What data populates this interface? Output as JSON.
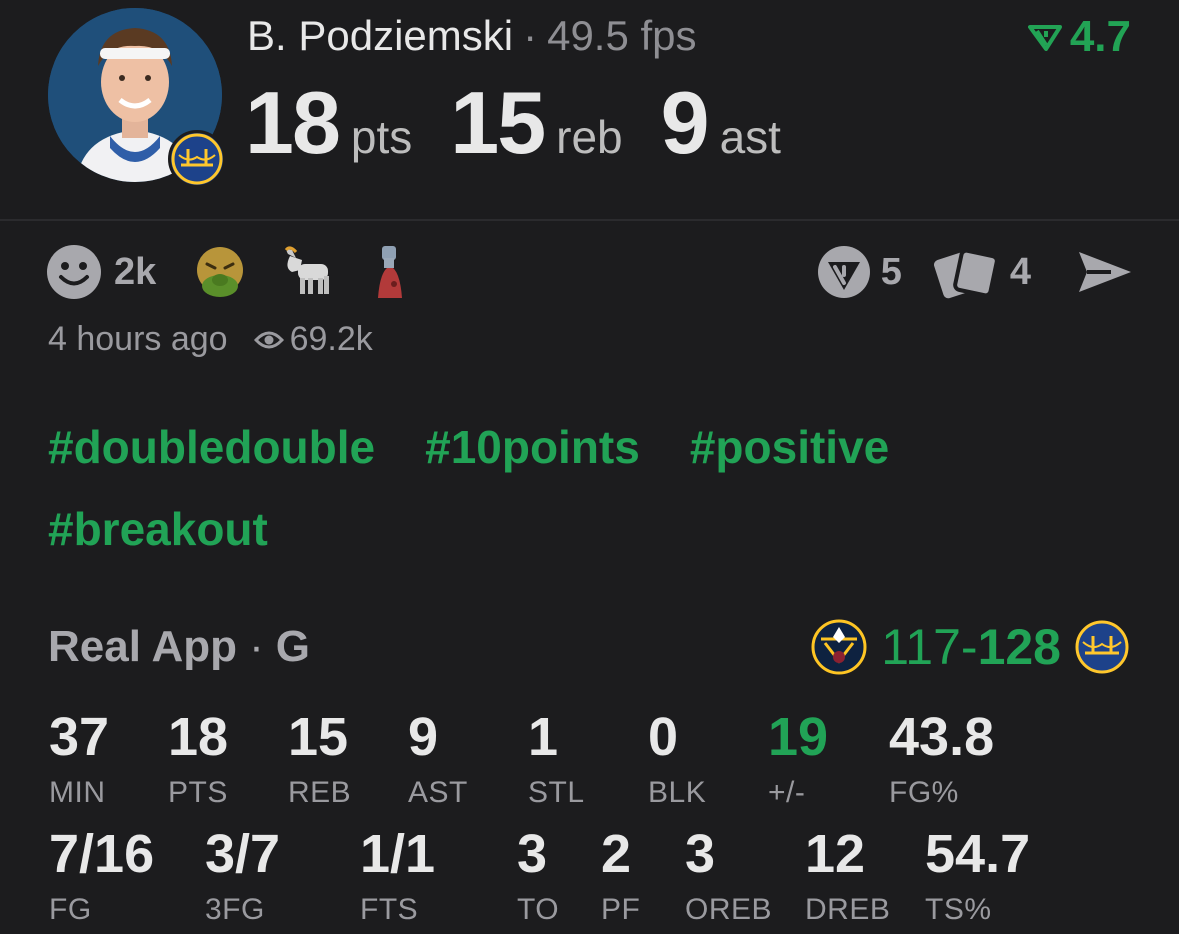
{
  "player": {
    "name": "B. Podziemski",
    "fps": "49.5 fps",
    "rating": "4.7"
  },
  "statline": [
    {
      "value": "18",
      "unit": "pts"
    },
    {
      "value": "15",
      "unit": "reb"
    },
    {
      "value": "9",
      "unit": "ast"
    }
  ],
  "reactions": {
    "smiley_count": "2k",
    "emojis": [
      "vomit-face-icon",
      "goat-icon",
      "fire-hydrant-icon"
    ]
  },
  "actions": {
    "verify_count": "5",
    "cards_count": "4"
  },
  "meta": {
    "time_ago": "4 hours ago",
    "views": "69.2k"
  },
  "hashtags": [
    "#doubledouble",
    "#10points",
    "#positive",
    "#breakout"
  ],
  "game": {
    "source": "Real App",
    "position": "G",
    "opp_score": "117",
    "separator": "-",
    "team_score": "128"
  },
  "stats_row1": [
    {
      "value": "37",
      "label": "MIN"
    },
    {
      "value": "18",
      "label": "PTS"
    },
    {
      "value": "15",
      "label": "REB"
    },
    {
      "value": "9",
      "label": "AST"
    },
    {
      "value": "1",
      "label": "STL"
    },
    {
      "value": "0",
      "label": "BLK"
    },
    {
      "value": "19",
      "label": "+/-"
    },
    {
      "value": "43.8",
      "label": "FG%"
    }
  ],
  "stats_row2": [
    {
      "value": "7/16",
      "label": "FG"
    },
    {
      "value": "3/7",
      "label": "3FG"
    },
    {
      "value": "1/1",
      "label": "FTS"
    },
    {
      "value": "3",
      "label": "TO"
    },
    {
      "value": "2",
      "label": "PF"
    },
    {
      "value": "3",
      "label": "OREB"
    },
    {
      "value": "12",
      "label": "DREB"
    },
    {
      "value": "54.7",
      "label": "TS%"
    }
  ],
  "colors": {
    "background": "#1c1c1e",
    "accent_green": "#21a356",
    "muted": "#9a9a9f"
  }
}
